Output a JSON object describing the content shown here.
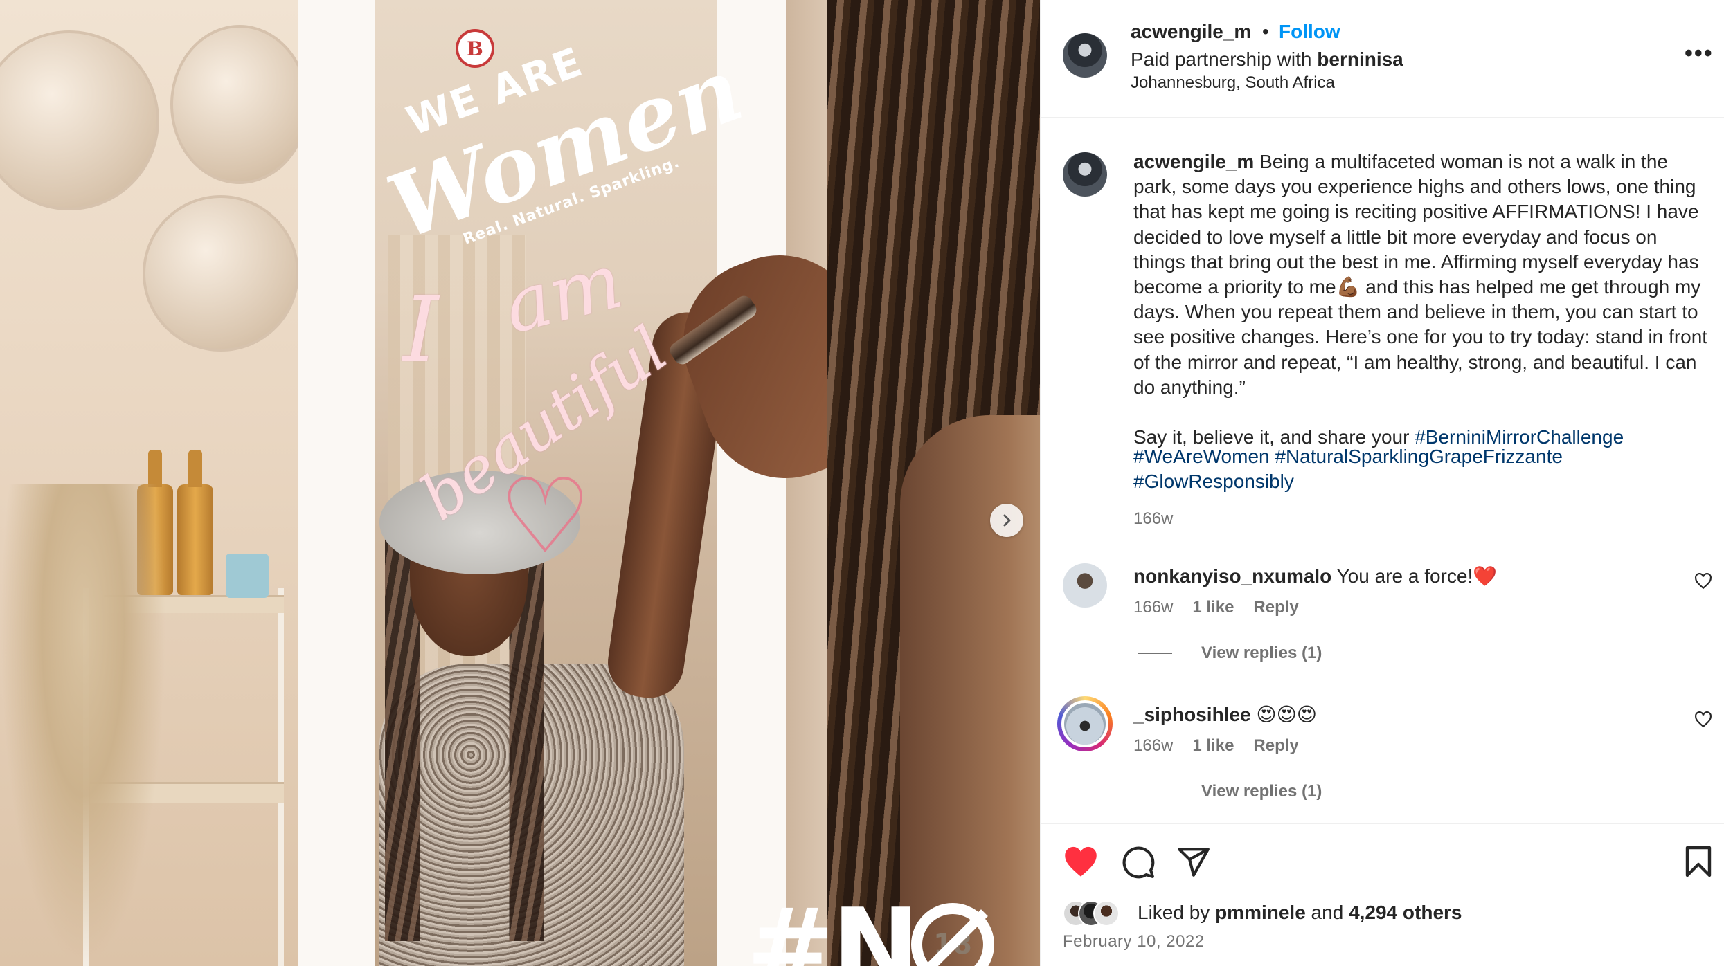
{
  "media": {
    "logo_letter": "B",
    "overlay_we_are": "WE ARE",
    "overlay_women": "Women",
    "overlay_tagline": "Real. Natural. Sparkling.",
    "scribble_i": "I",
    "scribble_am": "am",
    "scribble_beautiful": "beautiful",
    "hashtag_text": "#N",
    "age_badge": "18",
    "next_icon": "chevron-right-icon"
  },
  "header": {
    "username": "acwengile_m",
    "separator": "•",
    "follow_label": "Follow",
    "partnership_prefix": "Paid partnership with ",
    "partner_name": "berninisa",
    "location": "Johannesburg, South Africa",
    "more_label": "•••"
  },
  "caption": {
    "username": "acwengile_m",
    "text": " Being a multifaceted woman is not a walk in the park, some days you experience highs and others lows, one thing that has kept me going is reciting positive AFFIRMATIONS! I have decided to love myself a little bit more everyday and focus on things that bring out the best in me. Affirming myself everyday has become a priority to me💪🏾 and this has helped me get through my days. When you repeat them and believe in them, you can start to see positive changes. Here’s one for you to try today: stand in front of the mirror and repeat, “I am healthy, strong, and beautiful. I can do anything.”\n\nSay it, believe it, and share your ",
    "hashtags": [
      "#BerniniMirrorChallenge",
      "#WeAreWomen",
      "#NaturalSparklingGrapeFrizzante",
      "#GlowResponsibly"
    ],
    "time": "166w"
  },
  "comments": [
    {
      "username": "nonkanyiso_nxumalo",
      "text": " You are a force!❤️",
      "time": "166w",
      "likes": "1 like",
      "reply_label": "Reply",
      "view_replies": "View replies (1)"
    },
    {
      "username": "_siphosihlee",
      "text": " 😍😍😍",
      "time": "166w",
      "likes": "1 like",
      "reply_label": "Reply",
      "view_replies": "View replies (1)"
    }
  ],
  "actions": {
    "liked_by_prefix": "Liked by ",
    "liked_by_user": "pmminele",
    "liked_by_and": " and ",
    "liked_by_others": "4,294 others",
    "date": "February 10, 2022"
  },
  "colors": {
    "accent_blue": "#0095f6",
    "hashtag_blue": "#00376b",
    "like_red": "#ff3040",
    "secondary_text": "#737373"
  }
}
